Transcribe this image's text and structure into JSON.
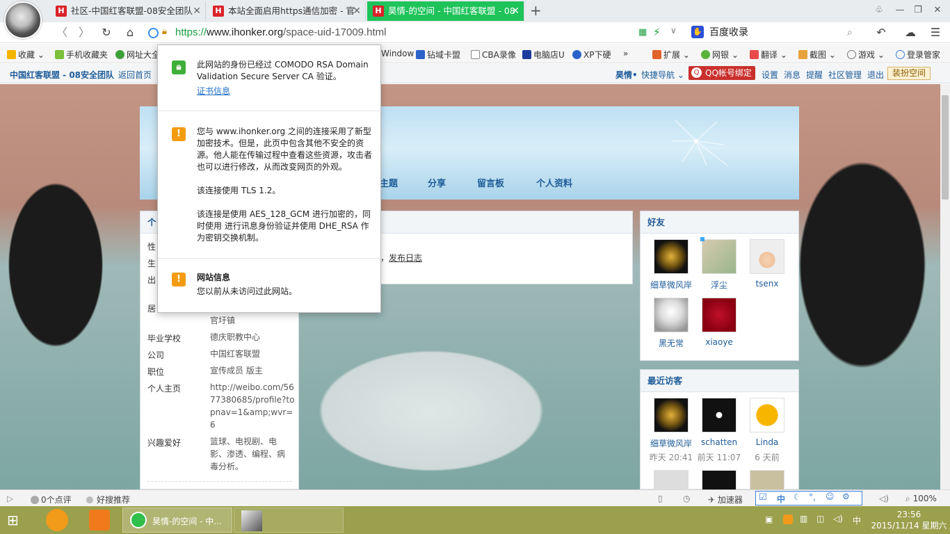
{
  "browser": {
    "tabs": [
      {
        "label": "社区-中国红客联盟-08安全团队"
      },
      {
        "label": "本站全面启用https通信加密 - 官"
      },
      {
        "label": "昊情-的空间 - 中国红客联盟 - 08"
      }
    ],
    "url": {
      "scheme": "https://",
      "host": "www.ihonker.org",
      "path": "/space-uid-17009.html"
    },
    "search_text": "百度收录",
    "bookmarks": [
      "收藏",
      "手机收藏夹",
      "网址大全",
      "Window",
      "钻域卡盟",
      "CBA录像",
      "电脑店U",
      "XP下硬",
      "»",
      "扩展",
      "网银",
      "翻译",
      "截图",
      "游戏",
      "登录管家"
    ]
  },
  "site": {
    "brand": "中国红客联盟 - 08安全团队",
    "home_link": "返回首页",
    "user": "昊情",
    "quick_nav": "快捷导航",
    "qq_bind": "QQ帐号绑定",
    "links": [
      "设置",
      "消息",
      "提醒",
      "社区管理",
      "退出"
    ],
    "dress_up": "装扮空间"
  },
  "space": {
    "nav": [
      "主题",
      "分享",
      "留言板",
      "个人资料"
    ],
    "profile_header": "个",
    "profile_labels_partial": [
      "性",
      "生",
      "出",
      "居"
    ],
    "profile_fragment": "官圩镇",
    "profile_rows": [
      {
        "label": "毕业学校",
        "value": "德庆职教中心"
      },
      {
        "label": "公司",
        "value": "中国红客联盟"
      },
      {
        "label": "职位",
        "value": "宣传成员 版主"
      },
      {
        "label": "个人主页",
        "value": "http://weibo.com/5677380685/profile?topnav=1&amp;wvr=6"
      },
      {
        "label": "兴趣爱好",
        "value": "篮球、电视剧、电影、渗透、编程、病毒分析。"
      }
    ],
    "main_link_prefix": "，",
    "main_link": "发布日志",
    "friends_title": "好友",
    "friends": [
      {
        "name": "细草微风岸"
      },
      {
        "name": "浮尘"
      },
      {
        "name": "tsenx"
      },
      {
        "name": "黑无常"
      },
      {
        "name": "xiaoye"
      }
    ],
    "visitors_title": "最近访客",
    "visitors": [
      {
        "name": "细草微风岸",
        "time": "昨天 20:41"
      },
      {
        "name": "schatten",
        "time": "前天 11:07"
      },
      {
        "name": "Linda",
        "time": "6 天前"
      }
    ]
  },
  "popup": {
    "identity": "此网站的身份已经过 COMODO RSA Domain Validation Secure Server CA 验证。",
    "cert_link": "证书信息",
    "conn_para1": "您与 www.ihonker.org 之间的连接采用了新型加密技术。但是，此页中包含其他不安全的资源。他人能在传输过程中查看这些资源，攻击者也可以进行修改，从而改变网页的外观。",
    "conn_para2": "该连接使用 TLS 1.2。",
    "conn_para3": "该连接是使用 AES_128_GCM 进行加密的，同时使用 进行讯息身份验证并使用 DHE_RSA 作为密钥交换机制。",
    "site_info_title": "网站信息",
    "site_info_text": "您以前从未访问过此网站。"
  },
  "statusbar": {
    "reviews": "0个点评",
    "recommend": "好搜推荐",
    "accelerator": "加速器",
    "ime": "中",
    "zoom": "100%"
  },
  "taskbar": {
    "window_title": "昊情-的空间 - 中...",
    "ime": "中",
    "time": "23:56",
    "date": "2015/11/14 星期六"
  },
  "colors": {
    "active_tab": "#1ec35a",
    "https_green": "#1a9e3f",
    "site_link": "#1f5c99",
    "warning": "#f39c12",
    "taskbar": "#9aa04c"
  }
}
